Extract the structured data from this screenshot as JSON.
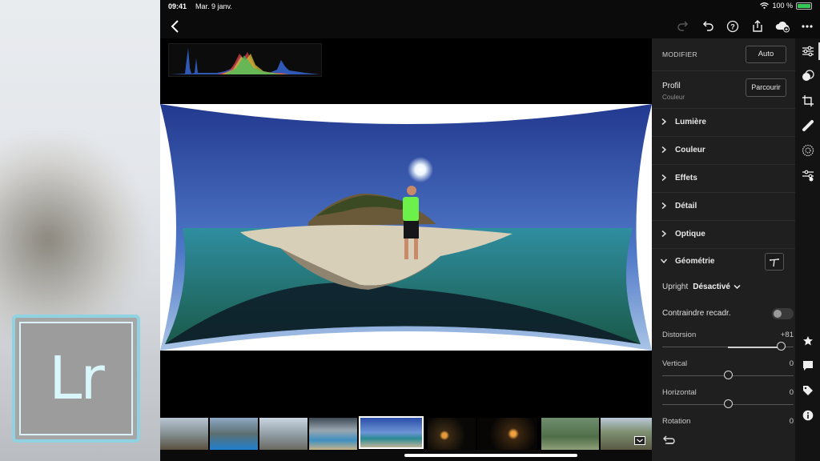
{
  "status_bar": {
    "time": "09:41",
    "date": "Mar. 9 janv.",
    "battery": "100 %"
  },
  "logo": {
    "text": "Lr"
  },
  "panel": {
    "header": "MODIFIER",
    "auto_label": "Auto",
    "profile_label": "Profil",
    "profile_value": "Couleur",
    "browse_label": "Parcourir",
    "sections": [
      "Lumière",
      "Couleur",
      "Effets",
      "Détail",
      "Optique"
    ],
    "geometry": {
      "label": "Géométrie",
      "upright_label": "Upright",
      "upright_value": "Désactivé",
      "constrain_label": "Contraindre recadr.",
      "constrain_on": false,
      "sliders": [
        {
          "label": "Distorsion",
          "value": "+81",
          "min": -100,
          "max": 100,
          "num": 81
        },
        {
          "label": "Vertical",
          "value": "0",
          "min": -100,
          "max": 100,
          "num": 0
        },
        {
          "label": "Horizontal",
          "value": "0",
          "min": -100,
          "max": 100,
          "num": 0
        },
        {
          "label": "Rotation",
          "value": "0",
          "min": -10,
          "max": 10,
          "num": 0
        }
      ]
    }
  },
  "toolbar_icons": [
    "redo-icon",
    "undo-icon",
    "help-icon",
    "share-icon",
    "cloud-sync-icon",
    "more-icon"
  ],
  "rail_icons": [
    "sliders-icon",
    "selective-icon",
    "crop-icon",
    "healing-icon",
    "radial-icon",
    "presets-icon",
    "star-icon",
    "comment-icon",
    "tag-icon",
    "info-icon"
  ],
  "colors": {
    "panel_bg": "#1f1f1f",
    "accent_battery": "#35c759",
    "logo_border": "#8fd3e2"
  }
}
